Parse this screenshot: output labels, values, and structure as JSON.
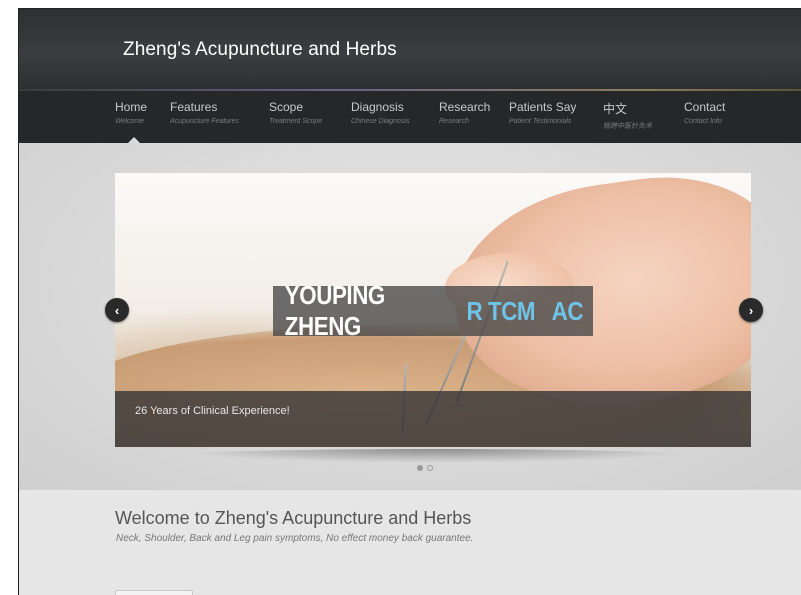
{
  "header": {
    "title": "Zheng's Acupuncture and Herbs"
  },
  "nav": {
    "items": [
      {
        "label": "Home",
        "sub": "Welcome"
      },
      {
        "label": "Features",
        "sub": "Acupuncture Features"
      },
      {
        "label": "Scope",
        "sub": "Treatment Scope"
      },
      {
        "label": "Diagnosis",
        "sub": "Chinese Diagnosis"
      },
      {
        "label": "Research",
        "sub": "Research"
      },
      {
        "label": "Patients Say",
        "sub": "Patient Testimonials"
      },
      {
        "label": "中文",
        "sub": "锁跨中医针灸术"
      },
      {
        "label": "Contact",
        "sub": "Contact Info"
      }
    ],
    "active_index": 0
  },
  "slider": {
    "banner_name": "YOUPING ZHENG",
    "banner_credentials": "R TCM   AC",
    "caption": "26 Years of Clinical Experience!",
    "prev_icon": "chevron-left-icon",
    "next_icon": "chevron-right-icon",
    "slide_count": 2,
    "active_slide": 1
  },
  "content": {
    "welcome_title": "Welcome to Zheng's Acupuncture and Herbs",
    "welcome_subtitle": "Neck, Shoulder, Back and Leg pain symptoms, No effect money back guarantee."
  },
  "colors": {
    "header_bg": "#333436",
    "nav_bg": "#262728",
    "credential_blue": "#6fc3e6",
    "page_bg": "#dcdcdc"
  }
}
